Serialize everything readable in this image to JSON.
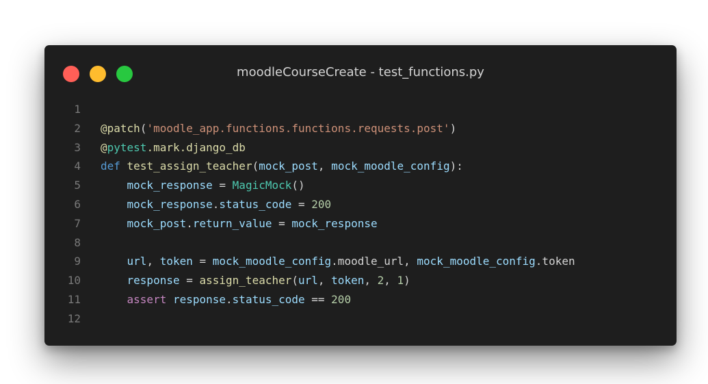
{
  "window": {
    "title": "moodleCourseCreate - test_functions.py",
    "controls": {
      "close_color": "#ff5f57",
      "minimize_color": "#febc2e",
      "maximize_color": "#28c840"
    }
  },
  "editor": {
    "language": "python",
    "theme": {
      "background": "#1e1e1e",
      "line_number": "#7a7a7a",
      "keyword": "#569cd6",
      "control_keyword": "#c586c0",
      "function": "#dcdcaa",
      "class": "#4ec9b0",
      "variable": "#9cdcfe",
      "string": "#ce9178",
      "number": "#b5cea8",
      "plain": "#d4d4d4"
    },
    "lines": [
      {
        "number": "1",
        "tokens": []
      },
      {
        "number": "2",
        "tokens": [
          {
            "t": "@",
            "c": "fn"
          },
          {
            "t": "patch",
            "c": "fn"
          },
          {
            "t": "(",
            "c": "plain"
          },
          {
            "t": "'moodle_app.functions.functions.requests.post'",
            "c": "str"
          },
          {
            "t": ")",
            "c": "plain"
          }
        ]
      },
      {
        "number": "3",
        "tokens": [
          {
            "t": "@",
            "c": "fn"
          },
          {
            "t": "pytest",
            "c": "cls"
          },
          {
            "t": ".mark.django_db",
            "c": "fn"
          }
        ]
      },
      {
        "number": "4",
        "tokens": [
          {
            "t": "def",
            "c": "kw"
          },
          {
            "t": " ",
            "c": "plain"
          },
          {
            "t": "test_assign_teacher",
            "c": "fn"
          },
          {
            "t": "(",
            "c": "plain"
          },
          {
            "t": "mock_post",
            "c": "var"
          },
          {
            "t": ", ",
            "c": "plain"
          },
          {
            "t": "mock_moodle_config",
            "c": "var"
          },
          {
            "t": "):",
            "c": "plain"
          }
        ]
      },
      {
        "number": "5",
        "tokens": [
          {
            "t": "    ",
            "c": "plain"
          },
          {
            "t": "mock_response",
            "c": "var"
          },
          {
            "t": " = ",
            "c": "plain"
          },
          {
            "t": "MagicMock",
            "c": "cls"
          },
          {
            "t": "()",
            "c": "plain"
          }
        ]
      },
      {
        "number": "6",
        "tokens": [
          {
            "t": "    ",
            "c": "plain"
          },
          {
            "t": "mock_response",
            "c": "var"
          },
          {
            "t": ".",
            "c": "plain"
          },
          {
            "t": "status_code",
            "c": "var"
          },
          {
            "t": " = ",
            "c": "plain"
          },
          {
            "t": "200",
            "c": "num"
          }
        ]
      },
      {
        "number": "7",
        "tokens": [
          {
            "t": "    ",
            "c": "plain"
          },
          {
            "t": "mock_post",
            "c": "var"
          },
          {
            "t": ".",
            "c": "plain"
          },
          {
            "t": "return_value",
            "c": "var"
          },
          {
            "t": " = ",
            "c": "plain"
          },
          {
            "t": "mock_response",
            "c": "var"
          }
        ]
      },
      {
        "number": "8",
        "tokens": []
      },
      {
        "number": "9",
        "tokens": [
          {
            "t": "    ",
            "c": "plain"
          },
          {
            "t": "url",
            "c": "var"
          },
          {
            "t": ", ",
            "c": "plain"
          },
          {
            "t": "token",
            "c": "var"
          },
          {
            "t": " = ",
            "c": "plain"
          },
          {
            "t": "mock_moodle_config",
            "c": "var"
          },
          {
            "t": ".moodle_url, ",
            "c": "plain"
          },
          {
            "t": "mock_moodle_config",
            "c": "var"
          },
          {
            "t": ".token",
            "c": "plain"
          }
        ]
      },
      {
        "number": "10",
        "tokens": [
          {
            "t": "    ",
            "c": "plain"
          },
          {
            "t": "response",
            "c": "var"
          },
          {
            "t": " = ",
            "c": "plain"
          },
          {
            "t": "assign_teacher",
            "c": "fn"
          },
          {
            "t": "(",
            "c": "plain"
          },
          {
            "t": "url",
            "c": "var"
          },
          {
            "t": ", ",
            "c": "plain"
          },
          {
            "t": "token",
            "c": "var"
          },
          {
            "t": ", ",
            "c": "plain"
          },
          {
            "t": "2",
            "c": "num"
          },
          {
            "t": ", ",
            "c": "plain"
          },
          {
            "t": "1",
            "c": "num"
          },
          {
            "t": ")",
            "c": "plain"
          }
        ]
      },
      {
        "number": "11",
        "tokens": [
          {
            "t": "    ",
            "c": "plain"
          },
          {
            "t": "assert",
            "c": "ctl"
          },
          {
            "t": " ",
            "c": "plain"
          },
          {
            "t": "response",
            "c": "var"
          },
          {
            "t": ".",
            "c": "plain"
          },
          {
            "t": "status_code",
            "c": "var"
          },
          {
            "t": " == ",
            "c": "plain"
          },
          {
            "t": "200",
            "c": "num"
          }
        ]
      },
      {
        "number": "12",
        "tokens": []
      }
    ]
  }
}
